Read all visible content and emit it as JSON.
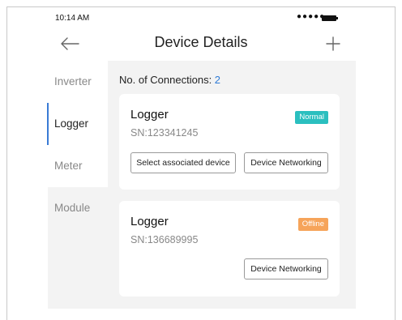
{
  "status_bar": {
    "time": "10:14 AM",
    "signal": "●●●●●"
  },
  "header": {
    "title": "Device Details"
  },
  "sidebar": {
    "items": [
      {
        "label": "Inverter"
      },
      {
        "label": "Logger"
      },
      {
        "label": "Meter"
      },
      {
        "label": "Module"
      }
    ],
    "selected": "Logger"
  },
  "main": {
    "connections_label": "No. of Connections: ",
    "connections_count": "2",
    "devices": [
      {
        "title": "Logger",
        "sn": "SN:123341245",
        "status": "Normal",
        "buttons": {
          "select": "Select associated device",
          "networking": "Device Networking"
        }
      },
      {
        "title": "Logger",
        "sn": "SN:136689995",
        "status": "Offline",
        "buttons": {
          "networking": "Device Networking"
        }
      }
    ]
  },
  "colors": {
    "accent": "#2f7bd6",
    "normal": "#2bbfbf",
    "offline": "#f6a45a",
    "panel_bg": "#f3f3f3"
  },
  "icons": {
    "back": "arrow-left-icon",
    "add": "plus-icon",
    "battery": "battery-icon"
  }
}
